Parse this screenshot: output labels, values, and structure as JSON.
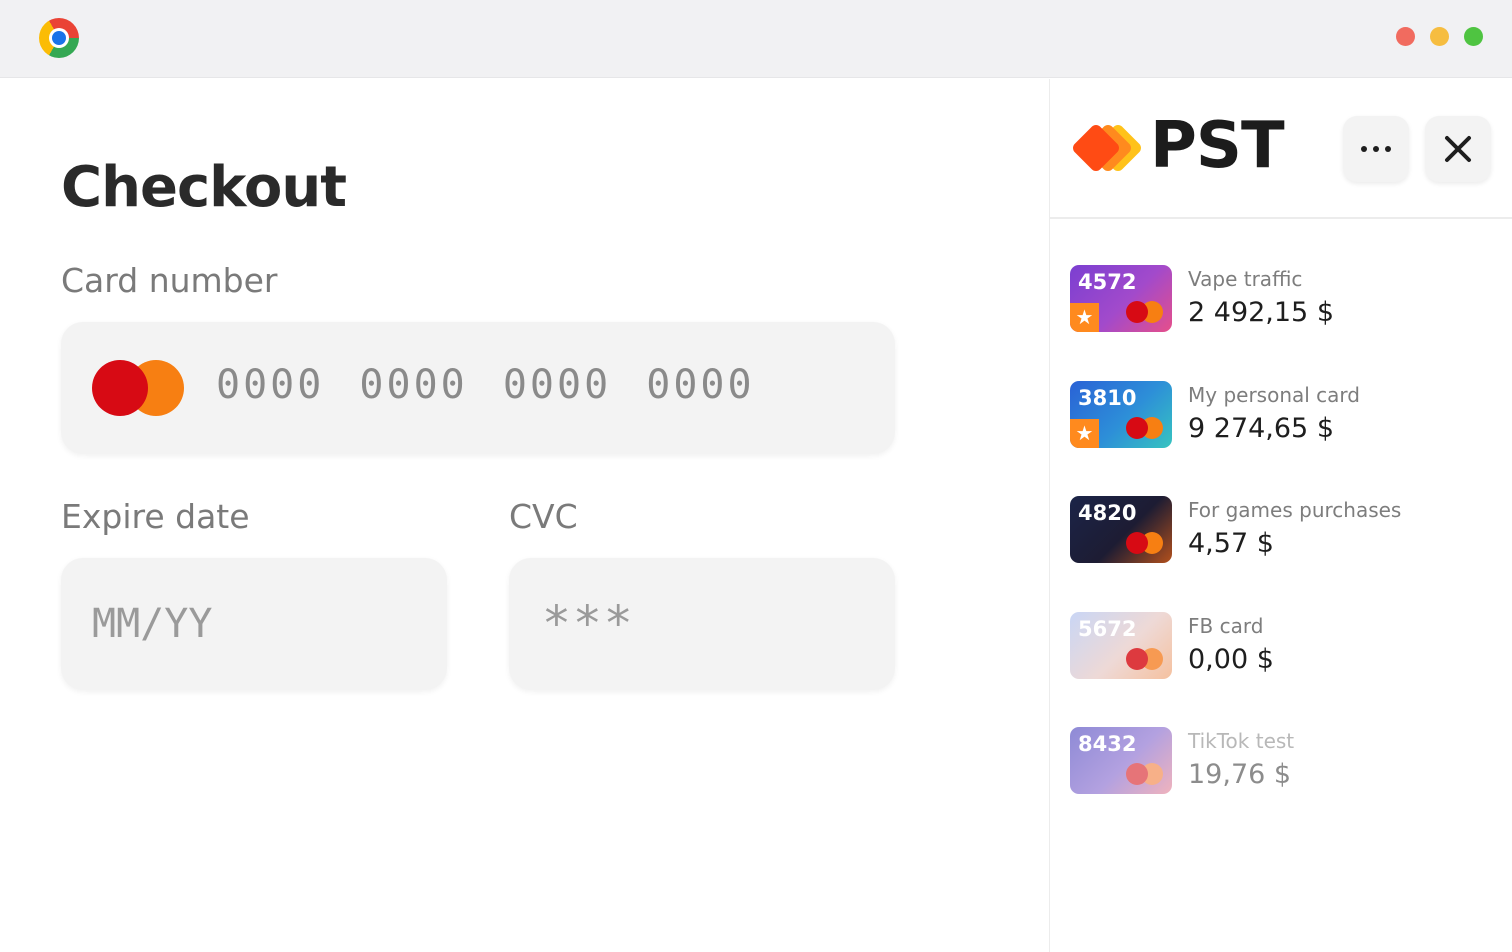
{
  "browser": {
    "logo_icon": "chrome-icon"
  },
  "main": {
    "title": "Checkout",
    "card_number_label": "Card number",
    "card_number_placeholder": "0000 0000 0000 0000",
    "expire_label": "Expire date",
    "expire_placeholder": "MM/YY",
    "cvc_label": "CVC",
    "cvc_placeholder": "***"
  },
  "panel": {
    "brand": "PST",
    "more_icon": "more-horizontal-icon",
    "close_icon": "close-icon",
    "cards": [
      {
        "number": "4572",
        "name": "Vape traffic",
        "amount": "2 492,15 $",
        "favorite": true
      },
      {
        "number": "3810",
        "name": "My personal card",
        "amount": "9 274,65 $",
        "favorite": true
      },
      {
        "number": "4820",
        "name": "For games purchases",
        "amount": "4,57 $",
        "favorite": false
      },
      {
        "number": "5672",
        "name": "FB card",
        "amount": "0,00 $",
        "favorite": false
      },
      {
        "number": "8432",
        "name": "TikTok test",
        "amount": "19,76 $",
        "favorite": false
      }
    ]
  },
  "colors": {
    "accent_orange": "#f77f12",
    "accent_red": "#d70a14",
    "brand_yellow": "#ffc21a"
  }
}
